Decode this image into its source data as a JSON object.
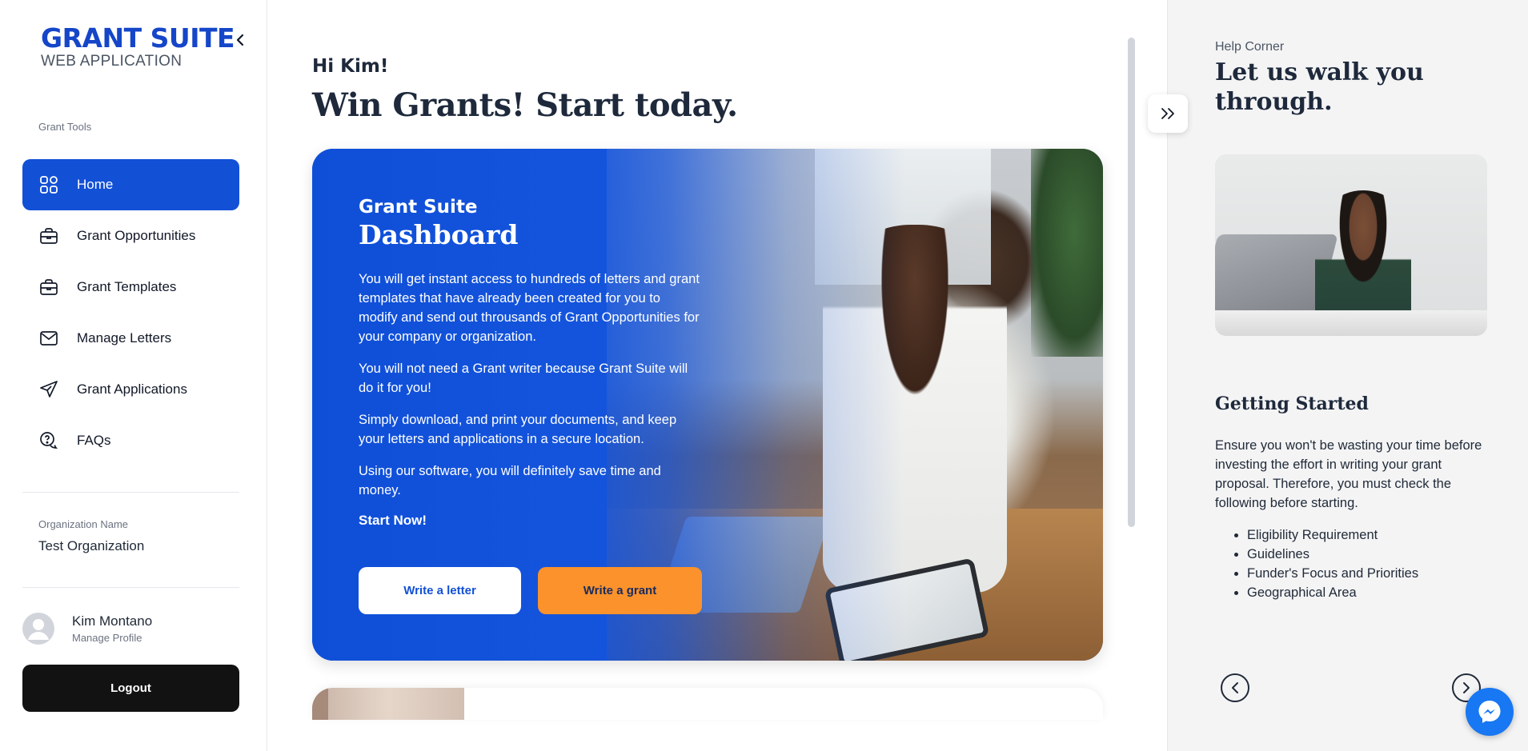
{
  "brand": {
    "title": "GRANT SUITE",
    "subtitle": "WEB APPLICATION",
    "accent": "#1250d6"
  },
  "sidebar": {
    "section_label": "Grant Tools",
    "items": [
      {
        "label": "Home",
        "icon": "grid-icon",
        "active": true
      },
      {
        "label": "Grant Opportunities",
        "icon": "briefcase-icon"
      },
      {
        "label": "Grant Templates",
        "icon": "briefcase-icon"
      },
      {
        "label": "Manage Letters",
        "icon": "mail-icon"
      },
      {
        "label": "Grant Applications",
        "icon": "send-icon"
      },
      {
        "label": "FAQs",
        "icon": "help-chat-icon"
      }
    ],
    "org_label": "Organization Name",
    "org_name": "Test Organization",
    "profile": {
      "name": "Kim Montano",
      "link": "Manage Profile"
    },
    "logout_label": "Logout"
  },
  "main": {
    "greeting": "Hi Kim!",
    "headline": "Win Grants! Start today.",
    "hero": {
      "kicker": "Grant Suite",
      "title": "Dashboard",
      "paragraphs": [
        "You will get instant access to hundreds of letters and grant templates that have already been created for you to modify and send out throusands of Grant Opportunities for your company or organization.",
        "You will not need a Grant writer because Grant Suite will do it for you!",
        "Simply download, and print your documents, and keep your letters and applications in a secure location.",
        "Using our software, you will definitely save time and money."
      ],
      "start_label": "Start Now!",
      "btn_letter": "Write a letter",
      "btn_grant": "Write a grant",
      "grant_color": "#fb922b"
    }
  },
  "help": {
    "label": "Help Corner",
    "title": "Let us walk you through.",
    "subtitle": "Getting Started",
    "text": "Ensure you won't be wasting your time before investing the effort in writing your grant proposal. Therefore, you must check the following before starting.",
    "list": [
      "Eligibility Requirement",
      "Guidelines",
      "Funder's Focus and Priorities",
      "Geographical Area"
    ]
  }
}
